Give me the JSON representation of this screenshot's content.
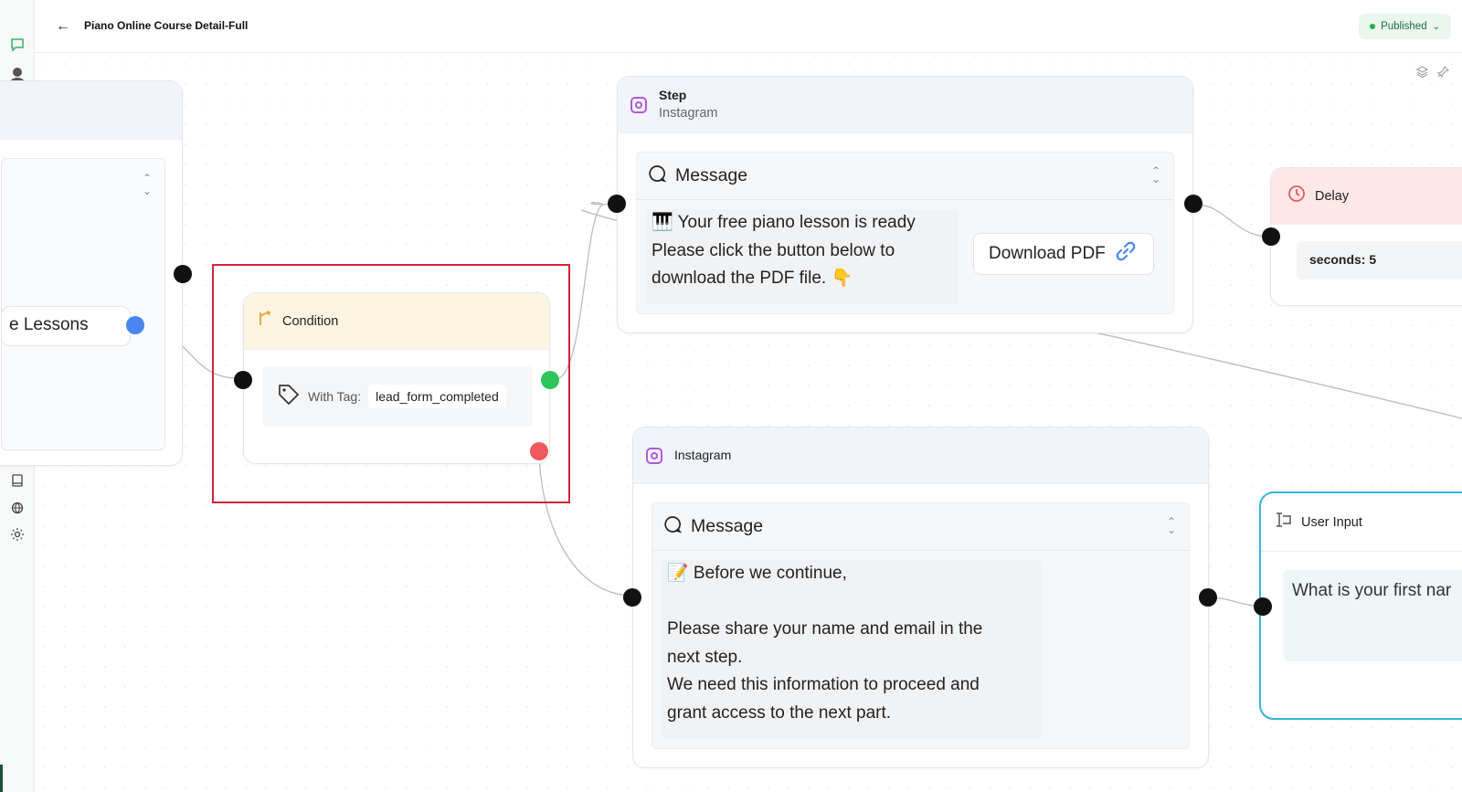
{
  "topbar": {
    "title": "Piano Online Course Detail-Full",
    "status": "Published",
    "status_color": "#22b04b"
  },
  "rail": {
    "icons": [
      "chat-bubble-icon",
      "user-avatar-icon",
      "home-icon",
      "inbox-icon",
      "flow-icon",
      "database-icon",
      "list-icon",
      "comment-icon",
      "message-square-icon",
      "users-icon",
      "cube-icon",
      "tag-icon",
      "ticket-icon",
      "settings-icon",
      "headset-icon",
      "book-icon",
      "globe-icon",
      "sun-icon"
    ]
  },
  "nodes": {
    "left": {
      "pill_label": "e Lessons"
    },
    "condition": {
      "title": "Condition",
      "tag_label": "With Tag:",
      "tag_value": "lead_form_completed",
      "header_color": "#fdf5e2"
    },
    "step": {
      "title": "Step",
      "subtitle": "Instagram",
      "message_title": "Message",
      "message_text": "🎹 Your free piano lesson is ready\nPlease click the button below to\ndownload the PDF file. 👇",
      "button_label": "Download PDF"
    },
    "delay": {
      "title": "Delay",
      "value": "seconds: 5",
      "header_color": "#fde7e7"
    },
    "ig2": {
      "title": "Instagram",
      "message_title": "Message",
      "message_text": "📝 Before we continue,\n\nPlease share your name and email in the\nnext step.\nWe need this information to proceed and\ngrant access to the next part."
    },
    "user_input": {
      "title": "User Input",
      "question": "What is your first nar"
    }
  }
}
